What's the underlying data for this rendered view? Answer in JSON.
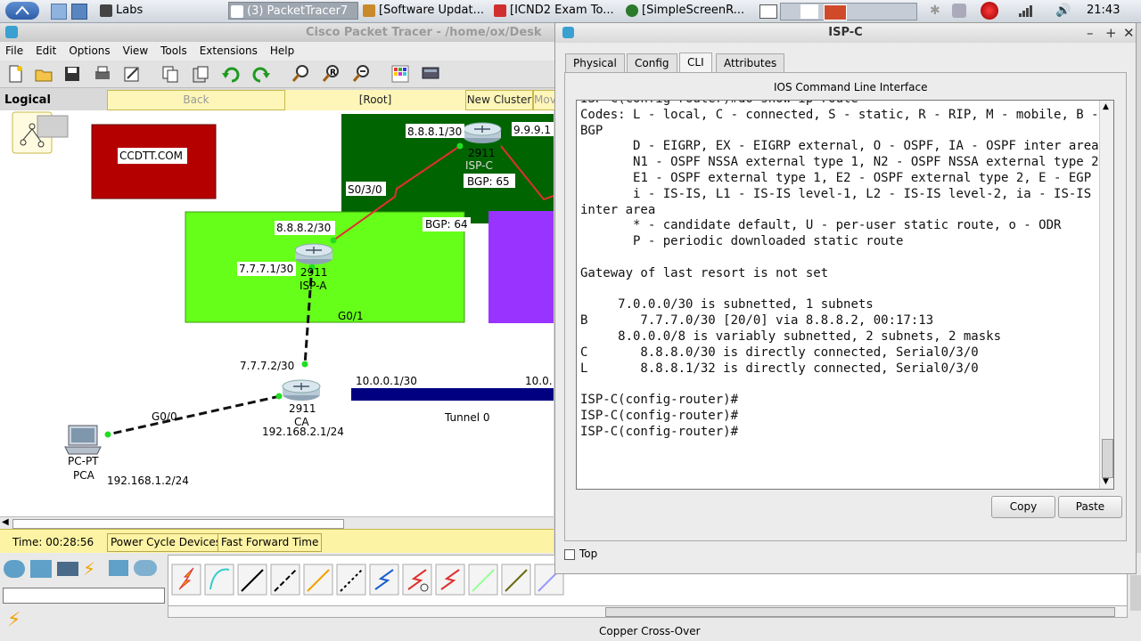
{
  "taskbar": {
    "tasks": [
      {
        "label": "Labs"
      },
      {
        "label": "(3) PacketTracer7"
      },
      {
        "label": "[Software Updat..."
      },
      {
        "label": "[ICND2 Exam To..."
      },
      {
        "label": "[SimpleScreenR..."
      }
    ],
    "clock": "21:43"
  },
  "pt": {
    "title": "Cisco Packet Tracer - /home/ox/Desk",
    "menu": [
      "File",
      "Edit",
      "Options",
      "View",
      "Tools",
      "Extensions",
      "Help"
    ],
    "nav": {
      "logical": "Logical",
      "back": "Back",
      "root": "[Root]",
      "new_cluster": "New Cluster",
      "move": "Mov"
    },
    "status": {
      "time": "Time: 00:28:56",
      "power_cycle": "Power Cycle Devices",
      "fast_forward": "Fast Forward Time"
    },
    "cable_label": "Copper Cross-Over"
  },
  "topology": {
    "ccdtt": "CCDTT.COM",
    "ispc_ip_left": "8.8.8.1/30",
    "ispc_ip_right": "9.9.9.1",
    "ispc_model": "2911",
    "ispc_name": "ISP-C",
    "ispc_bgp": "BGP: 65",
    "ispc_port": "S0/3/0",
    "ispa_ip_top": "8.8.8.2/30",
    "ispa_bgp": "BGP: 64",
    "ispa_ip_left": "7.7.7.1/30",
    "ispa_model": "2911",
    "ispa_name": "ISP-A",
    "ispa_port": "G0/1",
    "ca_ip": "7.7.7.2/30",
    "ca_model": "2911",
    "ca_name": "CA",
    "ca_lan": "192.168.2.1/24",
    "ca_port": "G0/0",
    "tunnel_ip_left": "10.0.0.1/30",
    "tunnel_ip_right": "10.0.",
    "tunnel_name": "Tunnel 0",
    "pc_type": "PC-PT",
    "pc_name": "PCA",
    "pc_ip": "192.168.1.2/24"
  },
  "ispc_window": {
    "title": "ISP-C",
    "tabs": [
      "Physical",
      "Config",
      "CLI",
      "Attributes"
    ],
    "cli_heading": "IOS Command Line Interface",
    "cli_output": "ISP-C(config-router)#do show ip route\nCodes: L - local, C - connected, S - static, R - RIP, M - mobile, B - BGP\n       D - EIGRP, EX - EIGRP external, O - OSPF, IA - OSPF inter area\n       N1 - OSPF NSSA external type 1, N2 - OSPF NSSA external type 2\n       E1 - OSPF external type 1, E2 - OSPF external type 2, E - EGP\n       i - IS-IS, L1 - IS-IS level-1, L2 - IS-IS level-2, ia - IS-IS inter area\n       * - candidate default, U - per-user static route, o - ODR\n       P - periodic downloaded static route\n\nGateway of last resort is not set\n\n     7.0.0.0/30 is subnetted, 1 subnets\nB       7.7.7.0/30 [20/0] via 8.8.8.2, 00:17:13\n     8.0.0.0/8 is variably subnetted, 2 subnets, 2 masks\nC       8.8.8.0/30 is directly connected, Serial0/3/0\nL       8.8.8.1/32 is directly connected, Serial0/3/0\n\nISP-C(config-router)#\nISP-C(config-router)#\nISP-C(config-router)#",
    "copy": "Copy",
    "paste": "Paste",
    "top_checkbox": "Top"
  },
  "colors": {
    "ccdtt_box": "#b50000",
    "ispc_area": "#006400",
    "ispa_area": "#66ff1a",
    "purple_area": "#9933ff",
    "serial_link": "#e03030",
    "tunnel": "#000080",
    "node_green": "#22dd22"
  }
}
